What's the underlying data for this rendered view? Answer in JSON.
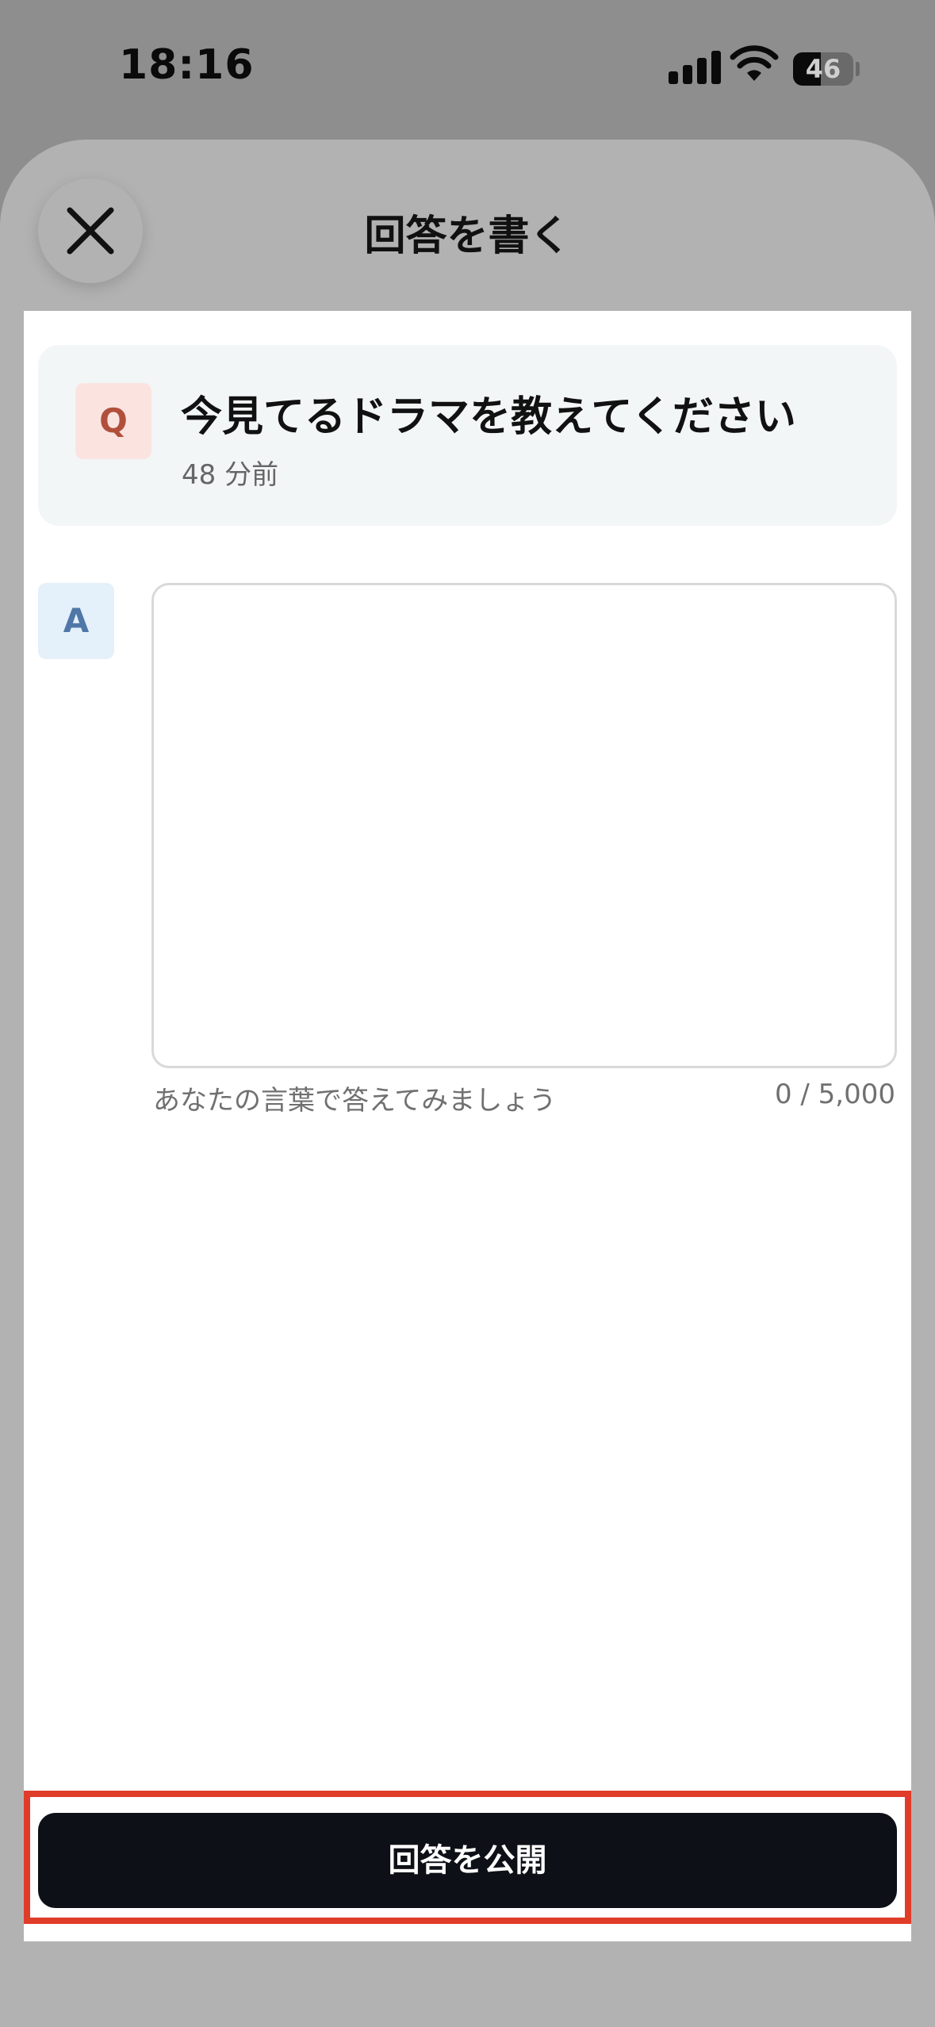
{
  "status_bar": {
    "time": "18:16",
    "battery_level": "46",
    "battery_fraction": 0.46,
    "signal_icon": "cellular-signal-icon",
    "wifi_icon": "wifi-icon"
  },
  "sheet": {
    "title": "回答を書く",
    "close_icon": "close-icon"
  },
  "question": {
    "badge": "Q",
    "title": "今見てるドラマを教えてください",
    "time": "48 分前"
  },
  "answer": {
    "badge": "A",
    "value": "",
    "hint": "あなたの言葉で答えてみましょう",
    "counter": "0 / 5,000"
  },
  "actions": {
    "publish_label": "回答を公開"
  },
  "colors": {
    "question_badge_bg": "#fbe4e0",
    "question_badge_text": "#b0503c",
    "answer_badge_bg": "#e4f0fa",
    "answer_badge_text": "#4f78a8",
    "publish_button_bg": "#0d1016",
    "highlight_border": "#e03c2a"
  }
}
